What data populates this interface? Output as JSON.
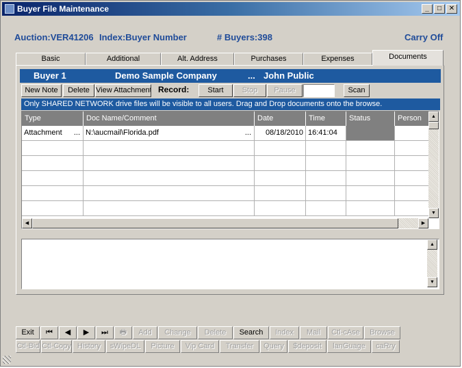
{
  "window": {
    "title": "Buyer File Maintenance",
    "minimize": "_",
    "maximize": "□",
    "close": "✕"
  },
  "info": {
    "auction": "Auction:VER41206",
    "index": "Index:Buyer Number",
    "buyers": "# Buyers:398",
    "carry": "Carry Off"
  },
  "tabs": [
    "Basic",
    "Additional",
    "Alt. Address",
    "Purchases",
    "Expenses",
    "Documents"
  ],
  "active_tab": "Documents",
  "buyer_bar": {
    "buyer": "Buyer 1",
    "company": "Demo Sample Company",
    "dots": "...",
    "name": "John Public"
  },
  "doc_toolbar": {
    "new_note": "New Note",
    "delete": "Delete",
    "view_attachment": "View Attachment",
    "record_label": "Record:",
    "start": "Start",
    "stop": "Stop",
    "pause": "Pause",
    "record_value": "",
    "scan": "Scan"
  },
  "notice": "Only SHARED NETWORK drive files will be visible to all users. Drag and Drop documents onto the browse.",
  "grid": {
    "columns": [
      "Type",
      "Doc Name/Comment",
      "Date",
      "Time",
      "Status",
      "Person"
    ],
    "rows": [
      {
        "type": "Attachment",
        "type_more": "...",
        "doc": "N:\\aucmail\\Florida.pdf",
        "doc_more": "...",
        "date": "08/18/2010",
        "time": "16:41:04",
        "status": "",
        "person": ""
      }
    ]
  },
  "memo": {
    "text": ""
  },
  "nav_row1": [
    "Exit",
    "⏮",
    "◀",
    "▶",
    "⏭",
    "🖶",
    "Add",
    "Change",
    "Delete",
    "Search",
    "Index",
    "Mail",
    "Ctl-cAse",
    "Browse"
  ],
  "nav_row2": [
    "Ctl-Bid",
    "Ctl-Copy",
    "History",
    "sWipeDL",
    "Picture",
    "Vip Card",
    "Transfer",
    "Query",
    "$deposit",
    "lanGuage",
    "caRry"
  ],
  "colors": {
    "title_start": "#0a246a",
    "accent_blue": "#1e5aa0",
    "info_text": "#1f4b99",
    "panel_bg": "#d4d0c8"
  }
}
